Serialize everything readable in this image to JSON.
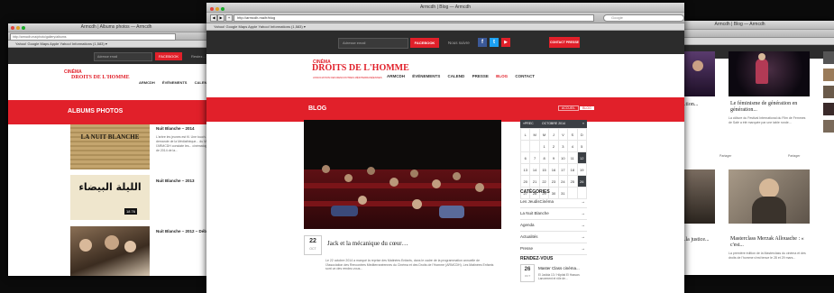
{
  "left_window": {
    "title": "Armcdh | Albums photos — Armcdh",
    "url": "http://armcdh.ma/photo/gallery/albums",
    "bookmarks": "Yahoo!   Google Maps   Apple   Yahoo!   Informations (1,583) ▾",
    "search_placeholder": "Adresse email",
    "subscribe": "FACEBOOK",
    "subscribe_extra": "Restez...",
    "logo_top": "CINÉMA",
    "logo_main": "DROITS DE L'HOMME",
    "nav": [
      "ARMCDH",
      "ÉVÉNEMENTS",
      "CALEND"
    ],
    "band_title": "ALBUMS PHOTOS",
    "albums": [
      {
        "title": "Nuit Blanche – 2014",
        "desc": "L'arbre les jeunes est fil. Une touch... sur la demande de la Médiathèque... du Maroc. l'ARMCDH constate les... cinématographique de 2014 de la...",
        "thumb": "LA NUIT BLANCHE"
      },
      {
        "title": "Nuit Blanche – 2013",
        "desc": "",
        "thumb": "الليلة البيضاء"
      },
      {
        "title": "Nuit Blanche – 2012 – Débat",
        "desc": "",
        "thumb": ""
      }
    ],
    "thumb_tag": "18 76"
  },
  "center_window": {
    "title": "Armcdh | Blog — Armcdh",
    "url": "http://armcdh.ma/fr/blog",
    "search_placeholder": "Google",
    "bookmarks": "Yahoo!   Google Maps   Apple   Yahoo!   Informations (1,583) ▾",
    "email_placeholder": "Adresse email",
    "subscribe_btn": "FACEBOOK",
    "follow_label": "Nous suivre",
    "social": [
      "f",
      "t",
      "▶"
    ],
    "contact_btn": "CONTACT PRESSE",
    "logo_top": "CINÉMA",
    "logo_main": "DROITS DE L'HOMME",
    "logo_sub": "ASSOCIATION DES RENCONTRES MÉDITERRANÉENNES",
    "nav": [
      "ARMCDH",
      "ÉVÉNEMENTS",
      "CALEND",
      "PRESSE",
      "BLOG",
      "CONTACT"
    ],
    "band_title": "BLOG",
    "breadcrumb": [
      "ACCUEIL",
      "BLOG"
    ],
    "post": {
      "day": "22",
      "month": "OCT",
      "title": "Jack et la mécanique du cœur…",
      "excerpt": "Le 22 octobre 2014 a marqué la reprise des Matinées Enfants, dans le cadre de la programmation annuelle de l'Association des Rencontres Méditerranéennes du Cinéma et des Droits de l'Homme (ARMCDH). Les Matinées Enfants sont un des rendez-vous..."
    },
    "calendar": {
      "header": [
        "«PREC",
        "OCTOBRE 2014",
        "»"
      ],
      "weekdays": [
        "L",
        "M",
        "M",
        "J",
        "V",
        "S",
        "D"
      ],
      "weeks": [
        [
          "",
          "",
          "1",
          "2",
          "3",
          "4",
          "5"
        ],
        [
          "6",
          "7",
          "8",
          "9",
          "10",
          "11",
          "12"
        ],
        [
          "13",
          "14",
          "15",
          "16",
          "17",
          "18",
          "19"
        ],
        [
          "20",
          "21",
          "22",
          "23",
          "24",
          "25",
          "26"
        ],
        [
          "27",
          "28",
          "29",
          "30",
          "31",
          "",
          ""
        ]
      ]
    },
    "categories_title": "CATÉGORIES",
    "categories": [
      "Les JeudisCinéma",
      "La Nuit Blanche",
      "Agenda",
      "Actualités",
      "Presse"
    ],
    "rdv_title": "RENDEZ-VOUS",
    "rdv": {
      "day": "26",
      "month": "OCT",
      "title": "Master Class cinéma...",
      "desc": "El Jadida 13 / Hôpital El Hassan. Lancement et rôle de..."
    }
  },
  "right_window": {
    "title": "Armcdh | Blog — Armcdh",
    "articles": [
      {
        "title": "Le féminisme de génération en génération...",
        "desc": "La clôture du Festival International du Film de Femmes de Salé a été marquée par une table ronde...",
        "meta": "Partager"
      },
      {
        "title": "...la justice...",
        "desc": "",
        "meta": "Partager"
      },
      {
        "title": "Masterclass Merzak Allouache : « c'est...",
        "desc": "La première édition de la Masterclass du cinéma et des droits de l'homme s'est tenue le 28 et 29 mars...",
        "meta": "Partager"
      }
    ],
    "partial_titles": [
      "...tion...",
      "...tive"
    ],
    "share": "Partager"
  },
  "colors": {
    "accent": "#e1202a",
    "dark": "#2c2c2c",
    "cal_dark": "#3b3f44"
  }
}
